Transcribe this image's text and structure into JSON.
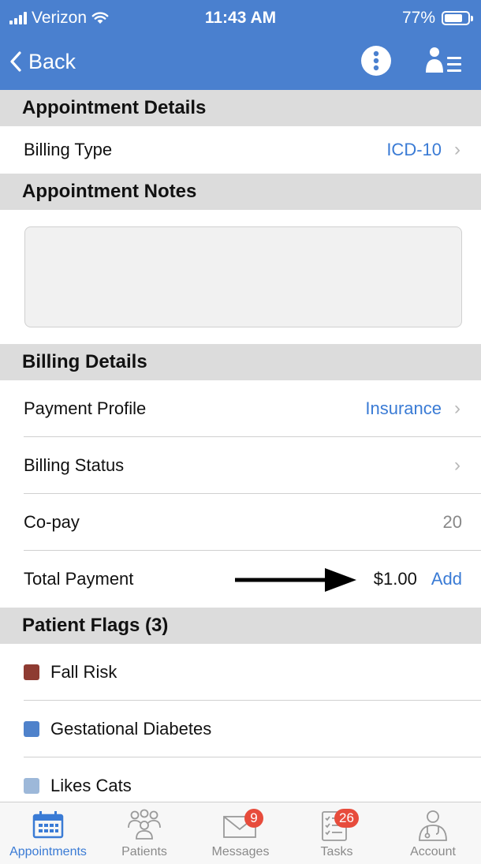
{
  "status_bar": {
    "carrier": "Verizon",
    "time": "11:43 AM",
    "battery": "77%",
    "battery_level": 0.77
  },
  "nav": {
    "back_label": "Back",
    "more_icon": "more-vertical-icon",
    "profile_icon": "person-list-icon"
  },
  "sections": {
    "appointment_details": "Appointment Details",
    "appointment_notes": "Appointment Notes",
    "billing_details": "Billing Details",
    "patient_flags": "Patient Flags (3)"
  },
  "billing_type": {
    "label": "Billing Type",
    "value": "ICD-10"
  },
  "notes": {
    "value": ""
  },
  "payment_profile": {
    "label": "Payment Profile",
    "value": "Insurance"
  },
  "billing_status": {
    "label": "Billing Status",
    "value": ""
  },
  "copay": {
    "label": "Co-pay",
    "value": "20"
  },
  "total_payment": {
    "label": "Total Payment",
    "amount": "$1.00",
    "action": "Add"
  },
  "flags": [
    {
      "label": "Fall Risk",
      "color": "#8e3b32"
    },
    {
      "label": "Gestational Diabetes",
      "color": "#4f82cb"
    },
    {
      "label": "Likes Cats",
      "color": "#9db8d9"
    }
  ],
  "tabs": [
    {
      "label": "Appointments",
      "icon": "calendar-icon",
      "active": true
    },
    {
      "label": "Patients",
      "icon": "patients-icon",
      "active": false
    },
    {
      "label": "Messages",
      "icon": "envelope-icon",
      "badge": "9",
      "active": false
    },
    {
      "label": "Tasks",
      "icon": "checklist-icon",
      "badge": "26",
      "active": false
    },
    {
      "label": "Account",
      "icon": "doctor-icon",
      "active": false
    }
  ],
  "colors": {
    "header_bg": "#4a80cf",
    "accent": "#3a7bd5",
    "section_bg": "#dcdcdc",
    "badge": "#e74c3c"
  }
}
